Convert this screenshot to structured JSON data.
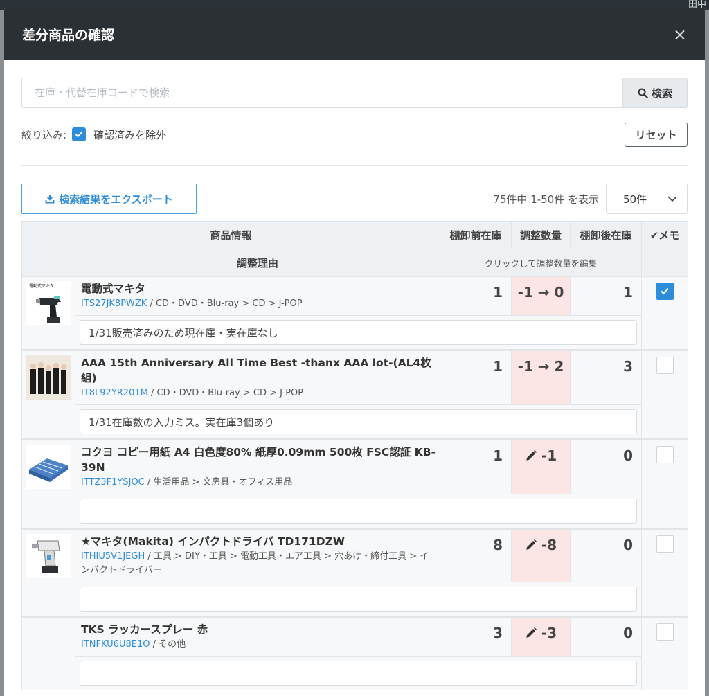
{
  "background": {
    "corner_text": "田中"
  },
  "modal": {
    "title": "差分商品の確認",
    "close": "×"
  },
  "search": {
    "placeholder": "在庫・代替在庫コードで検索",
    "button_label": "検索"
  },
  "filter": {
    "label": "絞り込み:",
    "option": "確認済みを除外",
    "checked": true,
    "reset_label": "リセット"
  },
  "toolbar": {
    "export_label": "検索結果をエクスポート",
    "count_text": "75件中 1-50件 を表示",
    "per_page": "50件"
  },
  "table": {
    "headers": {
      "product_info": "商品情報",
      "before": "棚卸前在庫",
      "adjust": "調整数量",
      "after": "棚卸後在庫",
      "memo": "✔メモ"
    },
    "subheaders": {
      "reason": "調整理由",
      "hint": "クリックして調整数量を編集"
    },
    "rows": [
      {
        "name": "電動式マキタ",
        "code": "ITS27JK8PWZK",
        "category": " / CD・DVD・Blu-ray > CD > J-POP",
        "before": "1",
        "adjust": "-1 → 0",
        "after": "1",
        "checked": true,
        "reason": "1/31販売済みのため現在庫・実在庫なし",
        "thumb": "drill-thumb"
      },
      {
        "name": "AAA 15th Anniversary All Time Best -thanx AAA lot-(AL4枚組)",
        "code": "IT8L92YR201M",
        "category": " / CD・DVD・Blu-ray > CD > J-POP",
        "before": "1",
        "adjust": "-1 → 2",
        "after": "3",
        "checked": false,
        "reason": "1/31在庫数の入力ミス。実在庫3個あり",
        "thumb": "album-thumb"
      },
      {
        "name": "コクヨ コピー用紙 A4 白色度80% 紙厚0.09mm 500枚 FSC認証 KB-39N",
        "code": "ITTZ3F1YSJOC",
        "category": " / 生活用品 > 文房具・オフィス用品",
        "before": "1",
        "adjust": "-1",
        "after": "0",
        "checked": false,
        "reason": "",
        "thumb": "paper-thumb"
      },
      {
        "name": "★マキタ(Makita) インパクトドライバ TD171DZW",
        "code": "ITHIU5V1JEGH",
        "category": " / 工具 > DIY・工具 > 電動工具・エア工具 > 穴あけ・締付工具 > インパクトドライバー",
        "before": "8",
        "adjust": "-8",
        "after": "0",
        "checked": false,
        "reason": "",
        "thumb": "driver-thumb"
      },
      {
        "name": "TKS ラッカースプレー 赤",
        "code": "ITNFKU6U8E1O",
        "category": " / その他",
        "before": "3",
        "adjust": "-3",
        "after": "0",
        "checked": false,
        "reason": "",
        "thumb": ""
      }
    ]
  },
  "colors": {
    "accent": "#2e8dd8",
    "header_dark": "#2b3035",
    "adjust_bg": "#fbe5e5"
  }
}
